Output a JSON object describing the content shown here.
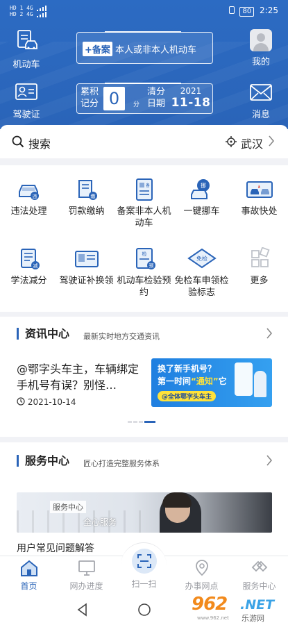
{
  "status_bar": {
    "network_1": "HD 1",
    "network_2": "HD 2",
    "signal_1": "4G",
    "signal_2": "4G",
    "battery": "80",
    "time": "2:25"
  },
  "header": {
    "vehicle_label": "机动车",
    "license_label": "驾驶证",
    "profile_label": "我的",
    "messages_label": "消息",
    "register_tag": "+备案",
    "register_text": "本人或非本人机动车",
    "score_label": "累积记分",
    "score_value": "0",
    "score_unit": "分",
    "clear_date_label": "清分日期",
    "clear_year": "2021",
    "clear_month_day": "11-18"
  },
  "search": {
    "placeholder": "搜索",
    "city": "武汉"
  },
  "services": [
    {
      "label": "违法处理",
      "icon": "violation-icon"
    },
    {
      "label": "罚款缴纳",
      "icon": "fine-payment-icon"
    },
    {
      "label": "备案非本人机动车",
      "icon": "vehicle-register-icon"
    },
    {
      "label": "一键挪车",
      "icon": "move-car-icon"
    },
    {
      "label": "事故快处",
      "icon": "accident-icon"
    },
    {
      "label": "学法减分",
      "icon": "study-deduct-icon"
    },
    {
      "label": "驾驶证补换领",
      "icon": "license-replace-icon"
    },
    {
      "label": "机动车检验预约",
      "icon": "inspection-booking-icon"
    },
    {
      "label": "免检车申领检验标志",
      "icon": "exempt-inspection-icon"
    },
    {
      "label": "更多",
      "icon": "more-icon"
    }
  ],
  "news": {
    "title": "资讯中心",
    "subtitle": "最新实时地方交通资讯",
    "item_title": "@鄂字头车主，车辆绑定手机号有误？别怪…",
    "item_date": "2021-10-14",
    "banner_line1": "换了新手机号？",
    "banner_line2_a": "第一时间",
    "banner_line2_b": "“通知”",
    "banner_line2_c": "它",
    "banner_tag": "@全体鄂字头车主"
  },
  "service_center": {
    "title": "服务中心",
    "subtitle": "匠心打造完整服务体系",
    "banner_tag": "服务中心",
    "banner_text": "全心服务",
    "faq": "用户常见问题解答"
  },
  "bottom_nav": [
    {
      "label": "首页",
      "active": true
    },
    {
      "label": "网办进度",
      "active": false
    },
    {
      "label": "扫一扫",
      "active": false
    },
    {
      "label": "办事网点",
      "active": false
    },
    {
      "label": "服务中心",
      "active": false
    }
  ],
  "watermark": {
    "brand_num": "962",
    "brand_net": ".NET",
    "brand_cn": "乐游网",
    "url": "www.962.net"
  },
  "colors": {
    "primary": "#2a64b8",
    "header_bg": "#2c6bc3",
    "page_bg": "#f1f2f6"
  }
}
